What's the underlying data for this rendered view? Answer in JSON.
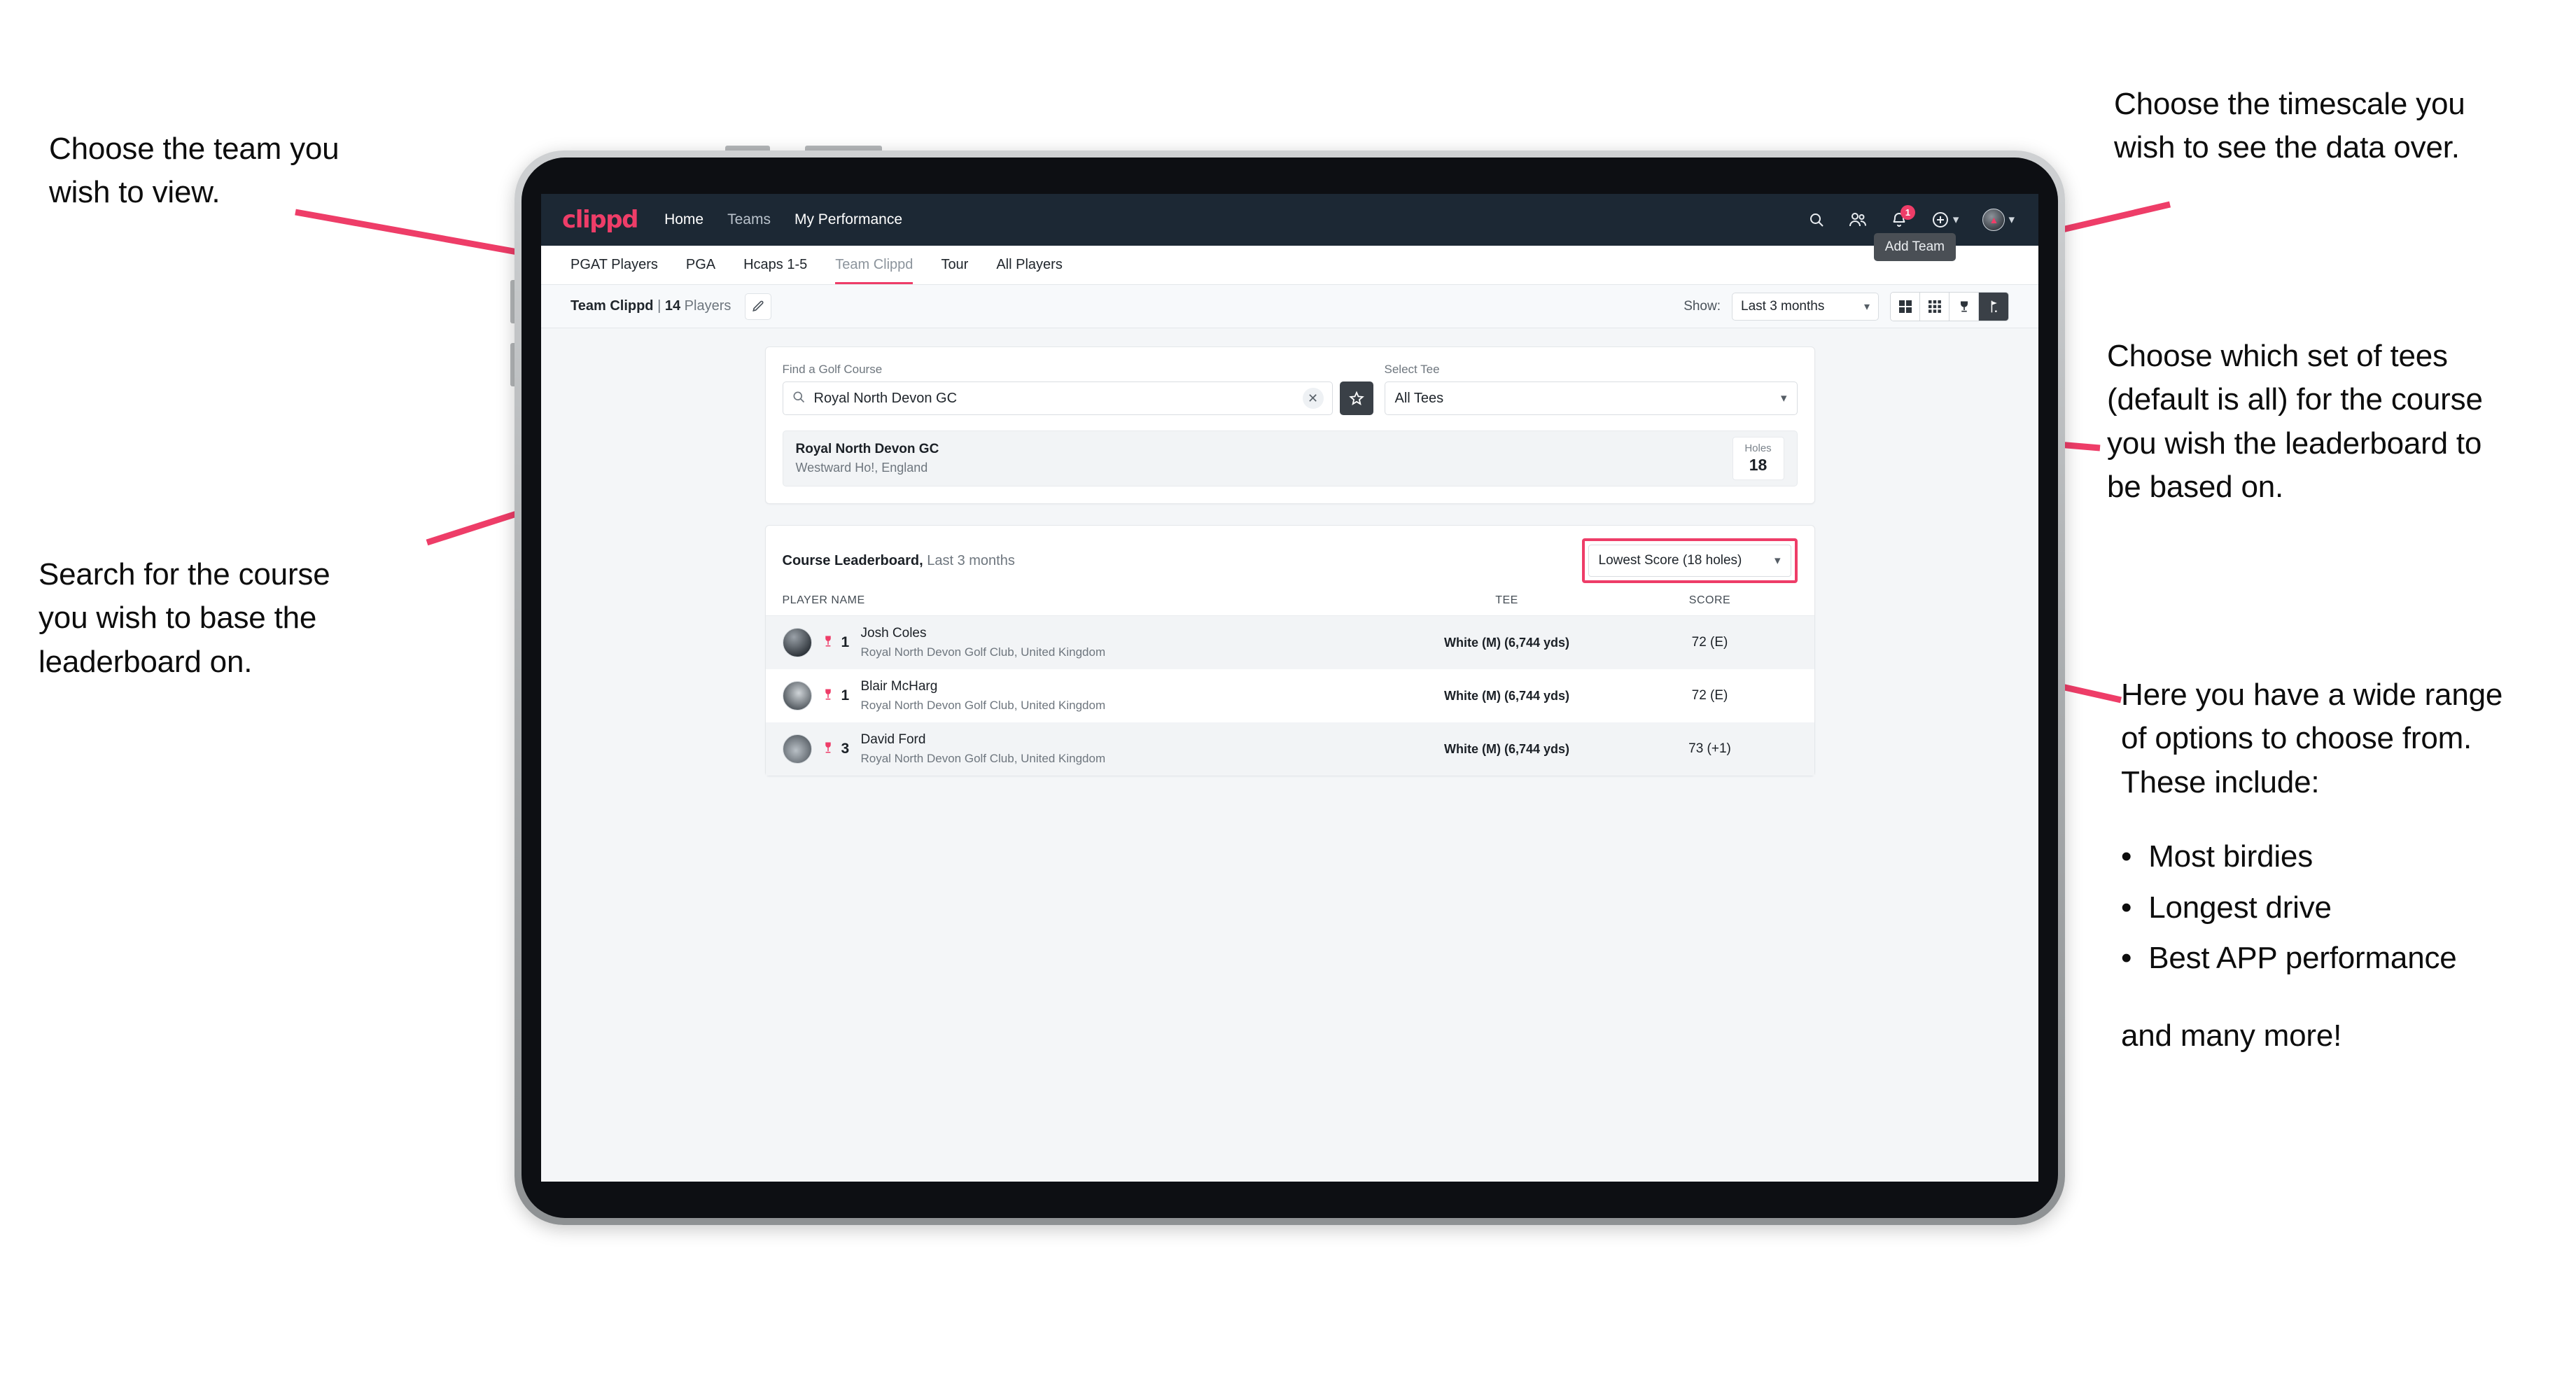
{
  "annotations": {
    "team": "Choose the team you\nwish to view.",
    "timescale": "Choose the timescale you\nwish to see the data over.",
    "tees": "Choose which set of tees\n(default is all) for the course\nyou wish the leaderboard to\nbe based on.",
    "search": "Search for the course\nyou wish to base the\nleaderboard on.",
    "options_intro": "Here you have a wide range\nof options to choose from.\nThese include:",
    "options_list": [
      "Most birdies",
      "Longest drive",
      "Best APP performance"
    ],
    "options_tail": "and many more!"
  },
  "navbar": {
    "logo": "clippd",
    "links": [
      {
        "label": "Home",
        "active": true
      },
      {
        "label": "Teams",
        "active": false
      },
      {
        "label": "My Performance",
        "active": true
      }
    ],
    "icons": [
      "search-icon",
      "people-icon",
      "bell-icon",
      "plus-circle-icon",
      "avatar-icon"
    ],
    "notification_count": "1",
    "tooltip": "Add Team"
  },
  "subtabs": [
    {
      "label": "PGAT Players",
      "active": false,
      "muted": false
    },
    {
      "label": "PGA",
      "active": false,
      "muted": false
    },
    {
      "label": "Hcaps 1-5",
      "active": false,
      "muted": false
    },
    {
      "label": "Team Clippd",
      "active": true,
      "muted": true
    },
    {
      "label": "Tour",
      "active": false,
      "muted": false
    },
    {
      "label": "All Players",
      "active": false,
      "muted": false
    }
  ],
  "toolbar": {
    "team_name": "Team Clippd",
    "separator": "|",
    "player_count": "14",
    "players_word": "Players",
    "edit_icon": "pencil-icon",
    "show_label": "Show:",
    "show_value": "Last 3 months",
    "view_buttons": [
      {
        "name": "grid-4-view",
        "active": false
      },
      {
        "name": "grid-9-view",
        "active": false
      },
      {
        "name": "trophy-view",
        "active": false
      },
      {
        "name": "golf-flag-view",
        "active": true
      }
    ]
  },
  "search_card": {
    "course_label": "Find a Golf Course",
    "course_value": "Royal North Devon GC",
    "course_placeholder": "Find a Golf Course",
    "clear_icon": "close-icon",
    "search_icon": "search-icon",
    "favourite_icon": "star-icon",
    "tee_label": "Select Tee",
    "tee_value": "All Tees"
  },
  "course_result": {
    "name": "Royal North Devon GC",
    "location": "Westward Ho!, England",
    "holes_label": "Holes",
    "holes_value": "18"
  },
  "leaderboard": {
    "title": "Course Leaderboard,",
    "subtitle": "Last 3 months",
    "metric": "Lowest Score (18 holes)",
    "columns": [
      "PLAYER NAME",
      "TEE",
      "SCORE"
    ],
    "rows": [
      {
        "rank": "1",
        "name": "Josh Coles",
        "club": "Royal North Devon Golf Club, United Kingdom",
        "tee": "White (M) (6,744 yds)",
        "score": "72 (E)"
      },
      {
        "rank": "1",
        "name": "Blair McHarg",
        "club": "Royal North Devon Golf Club, United Kingdom",
        "tee": "White (M) (6,744 yds)",
        "score": "72 (E)"
      },
      {
        "rank": "3",
        "name": "David Ford",
        "club": "Royal North Devon Golf Club, United Kingdom",
        "tee": "White (M) (6,744 yds)",
        "score": "73 (+1)"
      }
    ]
  },
  "colors": {
    "accent": "#ee3d68",
    "navbar": "#1c2834",
    "page_bg": "#f4f6f8",
    "active_toggle": "#3a4047"
  }
}
